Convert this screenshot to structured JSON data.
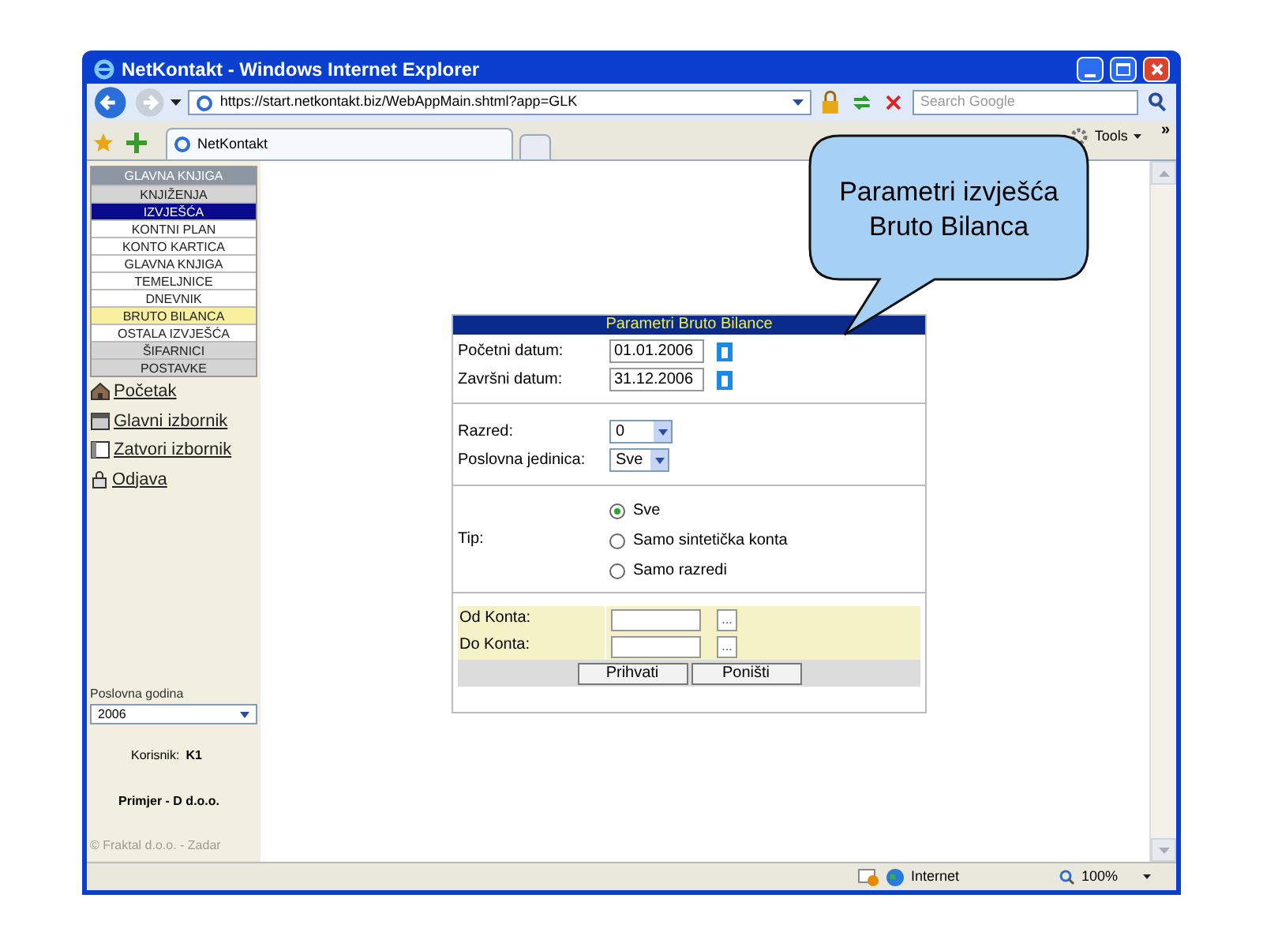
{
  "window": {
    "title": "NetKontakt - Windows Internet Explorer"
  },
  "toolbar": {
    "address": "https://start.netkontakt.biz/WebAppMain.shtml?app=GLK",
    "search_placeholder": "Search Google",
    "tab": "NetKontakt",
    "tools": "Tools",
    "more": "»"
  },
  "sidebar": {
    "header": "GLAVNA KNJIGA",
    "items": [
      {
        "label": "KNJIŽENJA",
        "kind": "section",
        "selected": false
      },
      {
        "label": "IZVJEŠĆA",
        "kind": "section",
        "selected": true
      },
      {
        "label": "KONTNI PLAN",
        "kind": "item",
        "selected": false
      },
      {
        "label": "KONTO KARTICA",
        "kind": "item",
        "selected": false
      },
      {
        "label": "GLAVNA KNJIGA",
        "kind": "item",
        "selected": false
      },
      {
        "label": "TEMELJNICE",
        "kind": "item",
        "selected": false
      },
      {
        "label": "DNEVNIK",
        "kind": "item",
        "selected": false
      },
      {
        "label": "BRUTO BILANCA",
        "kind": "item",
        "selected": true
      },
      {
        "label": "OSTALA IZVJEŠĆA",
        "kind": "item",
        "selected": false
      },
      {
        "label": "ŠIFARNICI",
        "kind": "section",
        "selected": false
      },
      {
        "label": "POSTAVKE",
        "kind": "section",
        "selected": false
      }
    ],
    "links": [
      {
        "label": "Početak",
        "kind": "home"
      },
      {
        "label": "Glavni izbornik",
        "kind": "menu"
      },
      {
        "label": "Zatvori izbornik",
        "kind": "close"
      },
      {
        "label": "Odjava",
        "kind": "lock"
      }
    ],
    "year_label": "Poslovna godina",
    "year_value": "2006",
    "user_label": "Korisnik:",
    "user_value": "K1",
    "company": "Primjer - D d.o.o.",
    "footer": "© Fraktal d.o.o. - Zadar"
  },
  "form": {
    "title": "Parametri Bruto Bilance",
    "dates": [
      {
        "label": "Početni datum:",
        "value": "01.01.2006"
      },
      {
        "label": "Završni datum:",
        "value": "31.12.2006"
      }
    ],
    "selects": [
      {
        "label": "Razred:",
        "value": "0"
      },
      {
        "label": "Poslovna jedinica:",
        "value": "Sve"
      }
    ],
    "type_label": "Tip:",
    "options": [
      {
        "label": "Sve",
        "selected": true
      },
      {
        "label": "Samo sintetička konta",
        "selected": false
      },
      {
        "label": "Samo razredi",
        "selected": false
      }
    ],
    "ranges": [
      {
        "label": "Od Konta:",
        "button": "..."
      },
      {
        "label": "Do Konta:",
        "button": "..."
      }
    ],
    "buttons": [
      "Prihvati",
      "Poništi"
    ]
  },
  "callout": {
    "lines": [
      "Parametri izvješća",
      "Bruto Bilanca"
    ]
  },
  "status_bar": {
    "zone": "Internet",
    "zoom": "100%"
  }
}
